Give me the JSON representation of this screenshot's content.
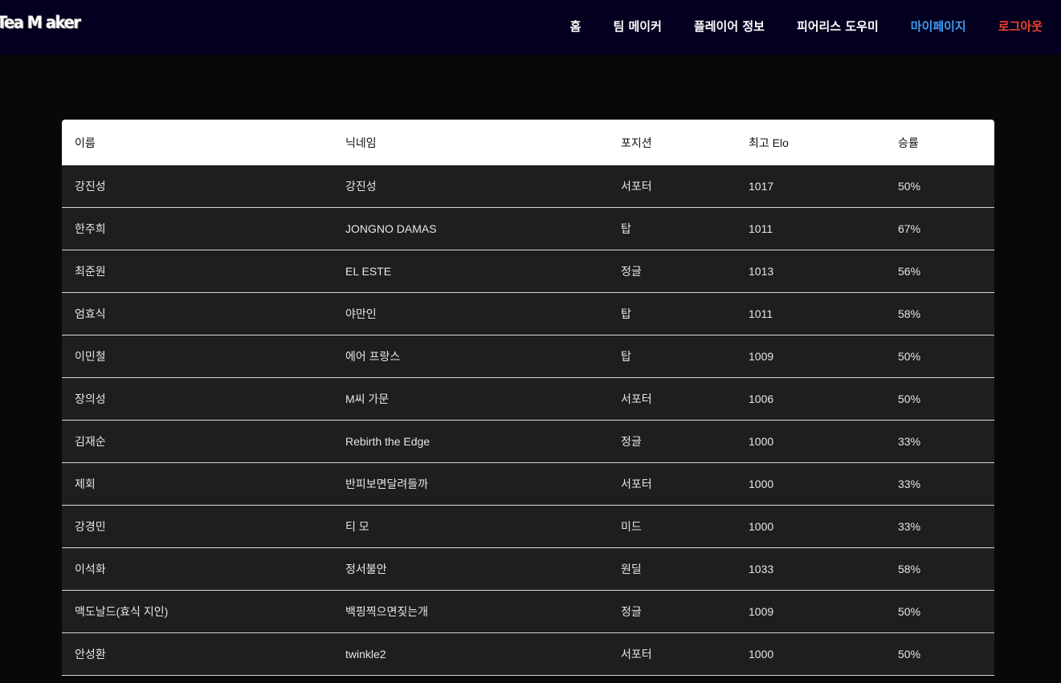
{
  "header": {
    "logo": "Tea M aker",
    "nav": [
      {
        "label": "홈"
      },
      {
        "label": "팀 메이커"
      },
      {
        "label": "플레이어 정보"
      },
      {
        "label": "피어리스 도우미"
      },
      {
        "label": "마이페이지"
      },
      {
        "label": "로그아웃"
      }
    ]
  },
  "table": {
    "columns": [
      "이름",
      "닉네임",
      "포지션",
      "최고 Elo",
      "승률"
    ],
    "rows": [
      [
        "강진성",
        "강진성",
        "서포터",
        "1017",
        "50%"
      ],
      [
        "한주희",
        "JONGNO DAMAS",
        "탑",
        "1011",
        "67%"
      ],
      [
        "최준원",
        "EL ESTE",
        "정글",
        "1013",
        "56%"
      ],
      [
        "엄효식",
        "야만인",
        "탑",
        "1011",
        "58%"
      ],
      [
        "이민철",
        "에어 프랑스",
        "탑",
        "1009",
        "50%"
      ],
      [
        "장의성",
        "M씨 가문",
        "서포터",
        "1006",
        "50%"
      ],
      [
        "김재순",
        "Rebirth the Edge",
        "정글",
        "1000",
        "33%"
      ],
      [
        "제회",
        "반피보면달려들까",
        "서포터",
        "1000",
        "33%"
      ],
      [
        "강경민",
        "티 모",
        "미드",
        "1000",
        "33%"
      ],
      [
        "이석화",
        "정서불안",
        "원딜",
        "1033",
        "58%"
      ],
      [
        "맥도날드(효식 지인)",
        "백핑찍으면짖는개",
        "정글",
        "1009",
        "50%"
      ],
      [
        "안성환",
        "twinkle2",
        "서포터",
        "1000",
        "50%"
      ]
    ]
  }
}
